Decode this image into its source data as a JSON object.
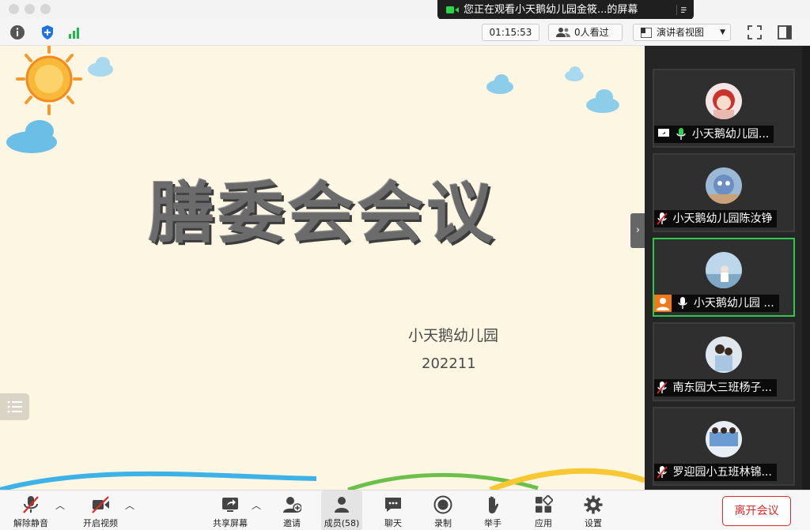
{
  "window": {
    "banner_text": "您正在观看小天鹅幼儿园金筱...的屏幕"
  },
  "topbar": {
    "timer": "01:15:53",
    "viewers": "0人看过",
    "view_mode": "演讲者视图"
  },
  "slide": {
    "title": "膳委会会议",
    "org": "小天鹅幼儿园",
    "date": "202211"
  },
  "gallery": {
    "participants": [
      {
        "name": "小天鹅幼儿园...",
        "sharing": true,
        "muted": false,
        "active": false
      },
      {
        "name": "小天鹅幼儿园陈汝铮",
        "sharing": false,
        "muted": true,
        "active": false
      },
      {
        "name": "小天鹅幼儿园 ...",
        "sharing": false,
        "muted": false,
        "active": true
      },
      {
        "name": "南东园大三班杨子...",
        "sharing": false,
        "muted": true,
        "active": false
      },
      {
        "name": "罗迎园小五班林锦...",
        "sharing": false,
        "muted": true,
        "active": false
      }
    ]
  },
  "toolbar": {
    "unmute": "解除静音",
    "start_video": "开启视频",
    "share_screen": "共享屏幕",
    "invite": "邀请",
    "participants": "成员(58)",
    "chat": "聊天",
    "record": "录制",
    "raise_hand": "举手",
    "apps": "应用",
    "settings": "设置",
    "leave": "离开会议"
  },
  "colors": {
    "active_border": "#2dc84d",
    "leave_red": "#e02828",
    "slide_bg": "#fdf6e3"
  }
}
